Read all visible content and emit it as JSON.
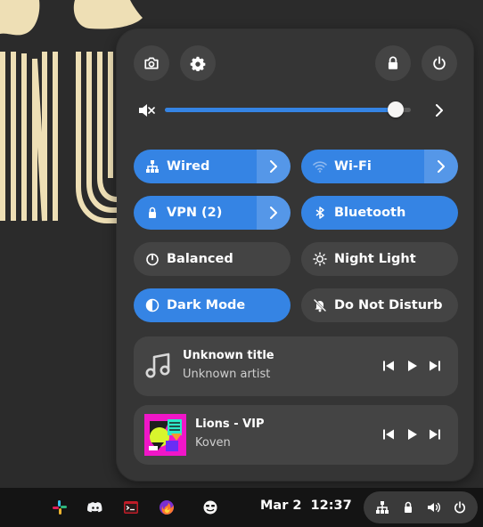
{
  "colors": {
    "accent": "#3584e4",
    "panel_bg": "#353535",
    "tile_off": "#444444",
    "taskbar_bg": "#141414",
    "wallpaper_bg": "#2b2b2b",
    "wallpaper_art": "#eedfb5"
  },
  "quick_settings": {
    "header_buttons": [
      "screenshot-icon",
      "settings-icon",
      "lock-icon",
      "power-icon"
    ],
    "volume": {
      "level_fraction": 0.94,
      "icon": "speaker-muted-icon"
    },
    "tiles": [
      {
        "label": "Wired",
        "icon": "network-wired-icon",
        "active": true,
        "has_menu": true
      },
      {
        "label": "Wi-Fi",
        "icon": "wifi-icon",
        "active": true,
        "has_menu": true
      },
      {
        "label": "VPN (2)",
        "icon": "vpn-lock-icon",
        "active": true,
        "has_menu": true
      },
      {
        "label": "Bluetooth",
        "icon": "bluetooth-icon",
        "active": true,
        "has_menu": false
      },
      {
        "label": "Balanced",
        "icon": "power-profile-icon",
        "active": false,
        "has_menu": false
      },
      {
        "label": "Night Light",
        "icon": "night-light-icon",
        "active": false,
        "has_menu": false
      },
      {
        "label": "Dark Mode",
        "icon": "dark-mode-icon",
        "active": true,
        "has_menu": false
      },
      {
        "label": "Do Not Disturb",
        "icon": "notifications-off-icon",
        "active": false,
        "has_menu": false
      }
    ],
    "media": [
      {
        "title": "Unknown title",
        "artist": "Unknown artist",
        "art": "music-note-icon"
      },
      {
        "title": "Lions - VIP",
        "artist": "Koven",
        "art": "album-art"
      }
    ]
  },
  "taskbar": {
    "apps": [
      "slack-icon",
      "discord-icon",
      "terminal-icon",
      "firefox-icon",
      "emoji-app-icon"
    ],
    "clock": {
      "date": "Mar 2",
      "time": "12:37"
    },
    "tray_icons": [
      "network-wired-icon",
      "vpn-lock-icon",
      "volume-icon",
      "power-icon"
    ]
  }
}
